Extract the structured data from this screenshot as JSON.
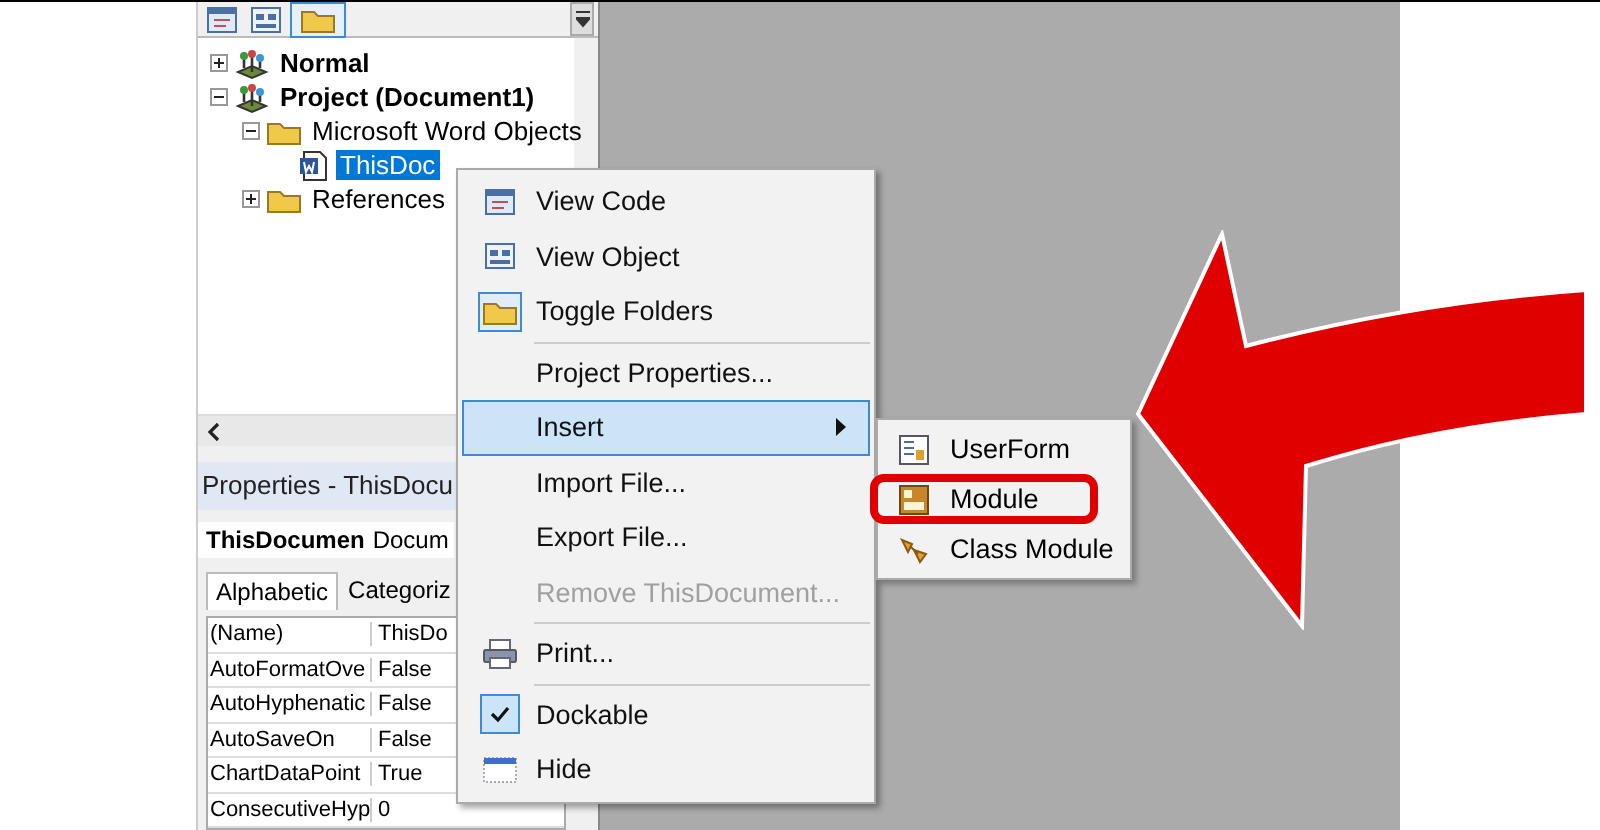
{
  "project_explorer": {
    "toolbar": [
      {
        "kind": "view-code",
        "selected": false
      },
      {
        "kind": "view-object",
        "selected": false
      },
      {
        "kind": "toggle-folders",
        "selected": true
      }
    ],
    "tree": [
      {
        "label": "Normal",
        "kind": "project",
        "expanded": false,
        "selected": false
      },
      {
        "label": "Project (Document1)",
        "kind": "project",
        "expanded": true,
        "selected": false,
        "children": [
          {
            "label": "Microsoft Word Objects",
            "kind": "folder",
            "expanded": true,
            "selected": false,
            "children": [
              {
                "label": "ThisDoc",
                "kind": "document",
                "selected": true
              }
            ]
          },
          {
            "label": "References",
            "kind": "folder",
            "expanded": false,
            "selected": false
          }
        ]
      }
    ]
  },
  "properties": {
    "title": "Properties - ThisDocu",
    "object_name": "ThisDocumen",
    "object_type": "Docum",
    "tabs": [
      {
        "label": "Alphabetic",
        "selected": true
      },
      {
        "label": "Categoriz",
        "selected": false
      }
    ],
    "rows": [
      {
        "name": "(Name)",
        "value": "ThisDo"
      },
      {
        "name": "AutoFormatOve",
        "value": "False"
      },
      {
        "name": "AutoHyphenatic",
        "value": "False"
      },
      {
        "name": "AutoSaveOn",
        "value": "False"
      },
      {
        "name": "ChartDataPoint",
        "value": "True"
      },
      {
        "name": "ConsecutiveHyp",
        "value": "0"
      }
    ]
  },
  "context_menu": {
    "items": [
      {
        "kind": "view-code",
        "label": "View Code",
        "selected": false,
        "disabled": false
      },
      {
        "kind": "view-object",
        "label": "View Object",
        "selected": false,
        "disabled": false
      },
      {
        "kind": "folder",
        "label": "Toggle Folders",
        "selected": false,
        "disabled": false
      },
      {
        "kind": "separator"
      },
      {
        "kind": "plain",
        "label": "Project Properties...",
        "selected": false,
        "disabled": false
      },
      {
        "kind": "submenu",
        "label": "Insert",
        "selected": true,
        "disabled": false
      },
      {
        "kind": "plain",
        "label": "Import File...",
        "selected": false,
        "disabled": false
      },
      {
        "kind": "plain",
        "label": "Export File...",
        "selected": false,
        "disabled": false
      },
      {
        "kind": "plain",
        "label": "Remove ThisDocument...",
        "selected": false,
        "disabled": true
      },
      {
        "kind": "separator"
      },
      {
        "kind": "printer",
        "label": "Print...",
        "selected": false,
        "disabled": false
      },
      {
        "kind": "separator"
      },
      {
        "kind": "check",
        "label": "Dockable",
        "selected": false,
        "disabled": false,
        "checked": true
      },
      {
        "kind": "window",
        "label": "Hide",
        "selected": false,
        "disabled": false
      }
    ]
  },
  "submenu": {
    "items": [
      {
        "kind": "userform",
        "label": "UserForm",
        "highlighted": false
      },
      {
        "kind": "module",
        "label": "Module",
        "highlighted": true
      },
      {
        "kind": "class-module",
        "label": "Class Module",
        "highlighted": false
      }
    ]
  }
}
